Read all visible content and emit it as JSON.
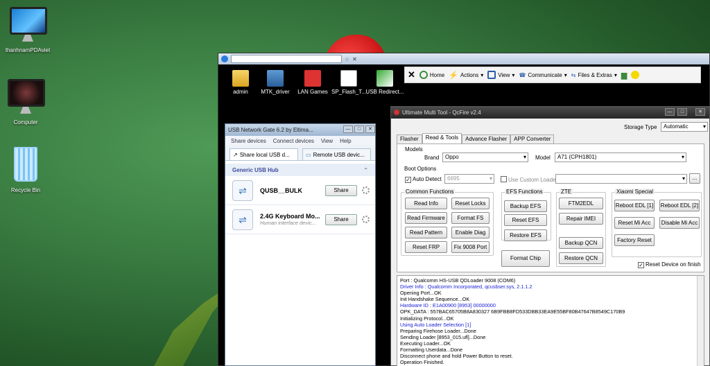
{
  "desktop": {
    "icons": [
      {
        "label": "thanhnamPDAviet"
      },
      {
        "label": "Computer"
      },
      {
        "label": "Recycle Bin"
      }
    ]
  },
  "remote": {
    "tab_title": "",
    "toolbar": {
      "home": "Home",
      "actions": "Actions",
      "view": "View",
      "communicate": "Communicate",
      "files": "Files & Extras"
    },
    "icons": [
      {
        "label": "admin"
      },
      {
        "label": "MTK_driver"
      },
      {
        "label": "LAN Games"
      },
      {
        "label": "SP_Flash_T..."
      },
      {
        "label": "USB Redirect..."
      }
    ]
  },
  "ung": {
    "title": "USB Network Gate 6.2 by Eltima...",
    "menu": [
      "Share devices",
      "Connect devices",
      "View",
      "Help"
    ],
    "tabs": [
      "Share local USB d...",
      "Remote USB devic..."
    ],
    "hub": "Generic USB Hub",
    "devices": [
      {
        "name": "QUSB__BULK",
        "desc": "",
        "button": "Share"
      },
      {
        "name": "2.4G Keyboard Mo...",
        "desc": "Human interface devic...",
        "button": "Share"
      }
    ]
  },
  "qc": {
    "title": "Ultimate Multi Tool - QcFire v2.4",
    "storage_label": "Storage Type",
    "storage_value": "Automatic",
    "tabs": [
      "Flasher",
      "Read & Tools",
      "Advance Flasher",
      "APP Converter"
    ],
    "models": {
      "legend": "Models",
      "brand_label": "Brand",
      "brand": "Oppo",
      "model_label": "Model",
      "model": "A71 (CPH1801)"
    },
    "boot": {
      "legend": "Boot Options",
      "auto_detect": "Auto Detect",
      "loader": "6695",
      "custom_loader": "Use Custom Loader",
      "browse": "..."
    },
    "common": {
      "legend": "Common Functions",
      "buttons": [
        "Read Info",
        "Reset Locks",
        "Read Firmware",
        "Format FS",
        "Read Pattern",
        "Enable Diag",
        "Reset FRP",
        "Fix 9008 Port"
      ]
    },
    "efs": {
      "legend": "EFS Functions",
      "buttons": [
        "Backup EFS",
        "Reset EFS",
        "Restore EFS"
      ],
      "format_chip": "Format Chip"
    },
    "zte": {
      "legend": "ZTE",
      "buttons": [
        "FTM2EDL",
        "Repair IMEI",
        "Backup QCN",
        "Restore QCN"
      ]
    },
    "xiaomi": {
      "legend": "Xiaomi Special",
      "buttons": [
        "Reboot EDL [1]",
        "Reboot EDL [2]",
        "Reset Mi Acc",
        "Disable Mi Acc",
        "Factory Reset"
      ]
    },
    "reset_on_finish": "Reset Device on finish",
    "log": [
      {
        "text": "Port         : Qualcomm HS-USB QDLoader 9008 (COM6)",
        "color": "black"
      },
      {
        "text": "Driver Info   : Qualcomm Incorporated, qcusbser.sys, 2.1.1.2",
        "color": "blue"
      },
      {
        "text": "Opening Port...OK",
        "color": "black"
      },
      {
        "text": "Init Handshake Sequence...OK",
        "color": "black"
      },
      {
        "text": "Hardware ID  : E1A00900 [8953] 00000000",
        "color": "blue"
      },
      {
        "text": "OPK_DATA    : 557BAC65705B8A830327 6B9FBB8FD533DBB33EA9E55BF80B47647B8549C170B9",
        "color": "black"
      },
      {
        "text": "Initializing Protocol...OK",
        "color": "black"
      },
      {
        "text": "Using Auto Loader Selection [1]",
        "color": "blue"
      },
      {
        "text": "Preparing Firehose Loader...Done",
        "color": "black"
      },
      {
        "text": "Sending Loader [8953_015.ufl]...Done",
        "color": "black"
      },
      {
        "text": "Executing Loader...OK",
        "color": "black"
      },
      {
        "text": "Formatting Userdata...Done",
        "color": "black"
      },
      {
        "text": "Disconnect phone and hold Power Button to reset.",
        "color": "black"
      },
      {
        "text": "Operation Finished.",
        "color": "black"
      }
    ]
  }
}
